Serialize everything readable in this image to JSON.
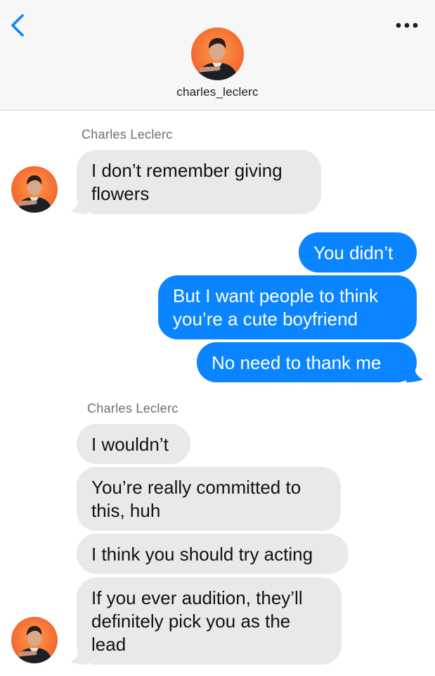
{
  "header": {
    "username": "charles_leclerc",
    "back_icon": "chevron-left-icon",
    "more_icon": "ellipsis-icon"
  },
  "colors": {
    "outgoing": "#0a84ff",
    "incoming": "#e9e9eb",
    "accent": "#0a84ff"
  },
  "messages": {
    "group1": {
      "sender": "Charles Leclerc",
      "m1_line1": "I don’t remember giving",
      "m1_line2": "flowers"
    },
    "outgoing": {
      "m1": "You didn’t",
      "m2_line1": "But I want people to think",
      "m2_line2": "you’re a cute boyfriend",
      "m3": "No need to thank me"
    },
    "group2": {
      "sender": "Charles Leclerc",
      "m1": "I wouldn’t",
      "m2_line1": "You’re really committed to",
      "m2_line2": "this, huh",
      "m3": "I think you should try acting",
      "m4_line1": "If you ever audition, they’ll",
      "m4_line2": "definitely pick you as the",
      "m4_line3": "lead"
    }
  }
}
